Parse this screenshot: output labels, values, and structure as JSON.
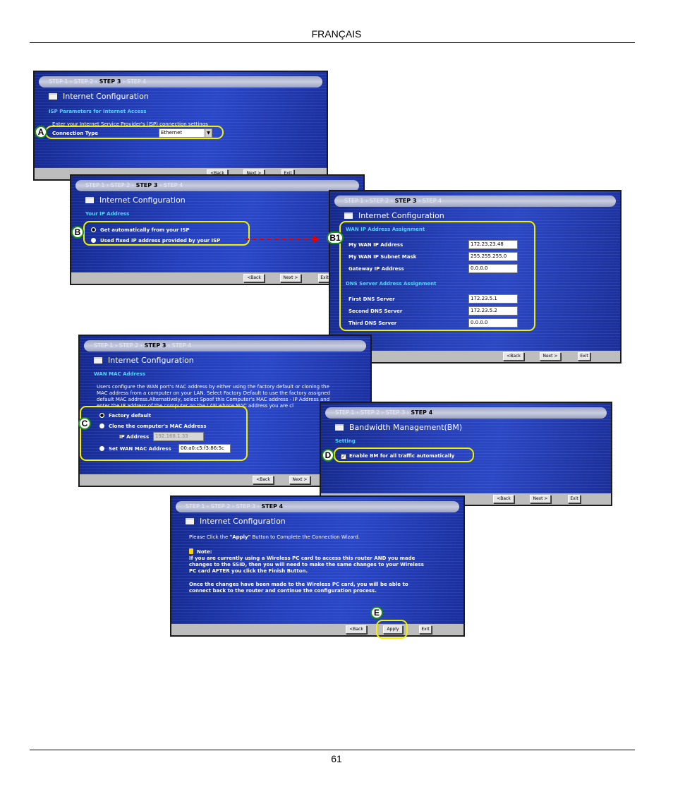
{
  "page": {
    "header": "FRANÇAIS",
    "page_number": "61"
  },
  "steps": {
    "s1": "STEP 1",
    "s2": "STEP 2",
    "s3": "STEP 3",
    "s4": "STEP 4",
    "sep": " › "
  },
  "buttons": {
    "back": "<Back",
    "next": "Next >",
    "exit": "Exit",
    "apply": "Apply"
  },
  "callouts": {
    "a": "A",
    "b": "B",
    "b1": "B1",
    "c": "C",
    "d": "D",
    "e": "E"
  },
  "panel_a": {
    "title": "Internet Configuration",
    "subtitle": "ISP Parameters for Internet Access",
    "instruction": "Enter your Internet Service Provider's (ISP) connection settings",
    "connection_type_label": "Connection Type",
    "connection_type_value": "Ethernet"
  },
  "panel_b": {
    "title": "Internet Configuration",
    "subtitle": "Your IP Address",
    "option_auto": "Get automatically from your ISP",
    "option_fixed": "Used fixed IP address provided by your ISP"
  },
  "panel_b1": {
    "title": "Internet Configuration",
    "wan_heading": "WAN IP Address Assignment",
    "wan_ip_label": "My WAN IP Address",
    "wan_ip_value": "172.23.23.48",
    "subnet_label": "My WAN IP Subnet Mask",
    "subnet_value": "255.255.255.0",
    "gateway_label": "Gateway IP Address",
    "gateway_value": "0.0.0.0",
    "dns_heading": "DNS Server Address Assignment",
    "dns1_label": "First DNS Server",
    "dns1_value": "172.23.5.1",
    "dns2_label": "Second DNS Server",
    "dns2_value": "172.23.5.2",
    "dns3_label": "Third DNS Server",
    "dns3_value": "0.0.0.0"
  },
  "panel_c": {
    "title": "Internet Configuration",
    "subtitle": "WAN MAC Address",
    "desc_1": "Users configure the WAN port's MAC address by either using the factory default or cloning the",
    "desc_2": "MAC address from a computer on your LAN. Select Factory Default to use the factory assigned",
    "desc_3": "default MAC address.Alternatively, select Spoof this Computer's MAC address - IP Address and",
    "desc_4": "enter the IP address of the computer on the LAN whose MAC address you are cl",
    "factory_default": "Factory default",
    "clone": "Clone the computer's MAC Address",
    "ip_label": "IP Address",
    "ip_value": "192.168.1.33",
    "set_mac": "Set WAN MAC Address",
    "mac_value": "00:a0:c5:f3:86:5c"
  },
  "panel_d": {
    "title": "Bandwidth Management(BM)",
    "subtitle": "Setting",
    "enable_bm": "Enable BM for all traffic automatically"
  },
  "panel_e": {
    "title": "Internet Configuration",
    "instruction_pre": "Please Click the ",
    "instruction_apply": "\"Apply\"",
    "instruction_post": " Button to Complete the Connection Wizard.",
    "note_label": "Note:",
    "note_1": "If you are currently using a Wireless PC card to access this router AND you made",
    "note_2": "changes to the SSID, then you will need to make the same changes to your Wireless",
    "note_3": "PC card AFTER you click the Finish Button.",
    "note_4": "Once the changes have been made to the Wireless PC card, you will be able to",
    "note_5": "connect back to the router and continue the configuration process."
  }
}
